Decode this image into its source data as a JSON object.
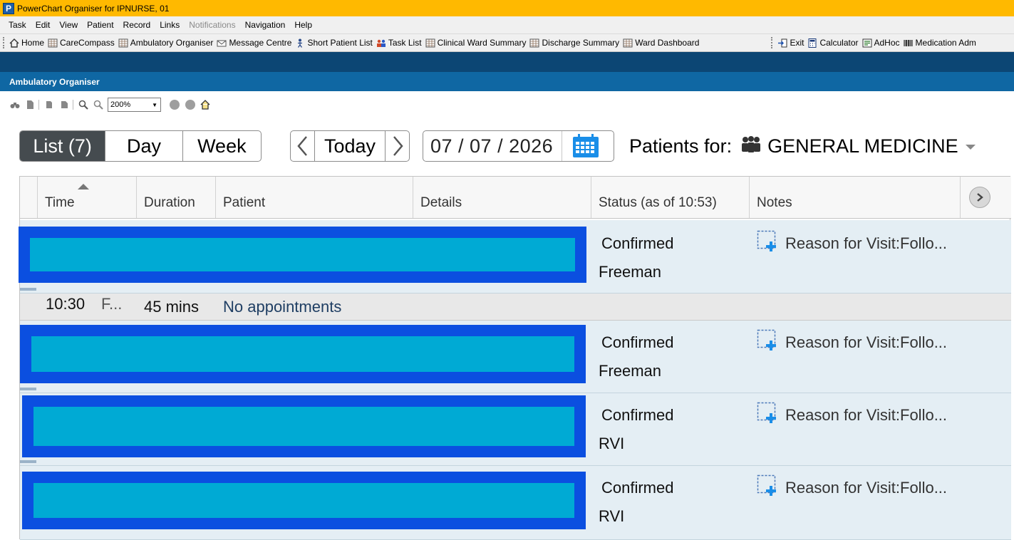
{
  "window": {
    "title": "PowerChart Organiser for IPNURSE, 01",
    "logo_letter": "P"
  },
  "menu": [
    {
      "label": "Task",
      "disabled": false
    },
    {
      "label": "Edit",
      "disabled": false
    },
    {
      "label": "View",
      "disabled": false
    },
    {
      "label": "Patient",
      "disabled": false
    },
    {
      "label": "Record",
      "disabled": false
    },
    {
      "label": "Links",
      "disabled": false
    },
    {
      "label": "Notifications",
      "disabled": true
    },
    {
      "label": "Navigation",
      "disabled": false
    },
    {
      "label": "Help",
      "disabled": false
    }
  ],
  "toolbar": {
    "left": [
      {
        "label": "Home",
        "icon": "home-icon"
      },
      {
        "label": "CareCompass",
        "icon": "grid-doc-icon"
      },
      {
        "label": "Ambulatory Organiser",
        "icon": "grid-doc-icon"
      },
      {
        "label": "Message Centre",
        "icon": "envelope-icon"
      },
      {
        "label": "Short Patient List",
        "icon": "person-icon"
      },
      {
        "label": "Task List",
        "icon": "people-icon"
      },
      {
        "label": "Clinical Ward Summary",
        "icon": "grid-doc-icon"
      },
      {
        "label": "Discharge Summary",
        "icon": "grid-doc-icon"
      },
      {
        "label": "Ward Dashboard",
        "icon": "grid-doc-icon"
      }
    ],
    "right": [
      {
        "label": "Exit",
        "icon": "exit-icon"
      },
      {
        "label": "Calculator",
        "icon": "calculator-icon"
      },
      {
        "label": "AdHoc",
        "icon": "adhoc-icon"
      },
      {
        "label": "Medication Adm",
        "icon": "barcode-icon"
      }
    ]
  },
  "section": {
    "title": "Ambulatory Organiser"
  },
  "zoom": {
    "value": "200%"
  },
  "view_tabs": [
    {
      "label": "List  (7)",
      "active": true
    },
    {
      "label": "Day",
      "active": false
    },
    {
      "label": "Week",
      "active": false
    }
  ],
  "nav": {
    "prev": "‹",
    "today": "Today",
    "next": "›"
  },
  "date": {
    "value": "07 / 07 / 2026"
  },
  "patients_for": {
    "label": "Patients for:",
    "value": "GENERAL MEDICINE"
  },
  "columns": [
    {
      "key": "time",
      "label": "Time"
    },
    {
      "key": "duration",
      "label": "Duration"
    },
    {
      "key": "patient",
      "label": "Patient"
    },
    {
      "key": "details",
      "label": "Details"
    },
    {
      "key": "status",
      "label": "Status (as of 10:53)"
    },
    {
      "key": "notes",
      "label": "Notes"
    }
  ],
  "rows": [
    {
      "type": "appointment",
      "status": "Confirmed",
      "location": "Freeman",
      "note": "Reason for Visit:Follo..."
    },
    {
      "type": "gap",
      "time": "10:30",
      "type_abbrev": "F...",
      "duration": "45 mins",
      "text": "No appointments"
    },
    {
      "type": "appointment",
      "status": "Confirmed",
      "location": "Freeman",
      "note": "Reason for Visit:Follo..."
    },
    {
      "type": "appointment",
      "status": "Confirmed",
      "location": "RVI",
      "note": "Reason for Visit:Follo..."
    },
    {
      "type": "appointment",
      "status": "Confirmed",
      "location": "RVI",
      "note": "Reason for Visit:Follo..."
    }
  ],
  "colors": {
    "title_bar": "#ffb900",
    "nav_dark": "#0c4674",
    "nav_blue": "#0f67a3",
    "redaction_outer": "#0b4fe0",
    "redaction_inner": "#00aad4",
    "row_bg": "#e4eef4"
  }
}
